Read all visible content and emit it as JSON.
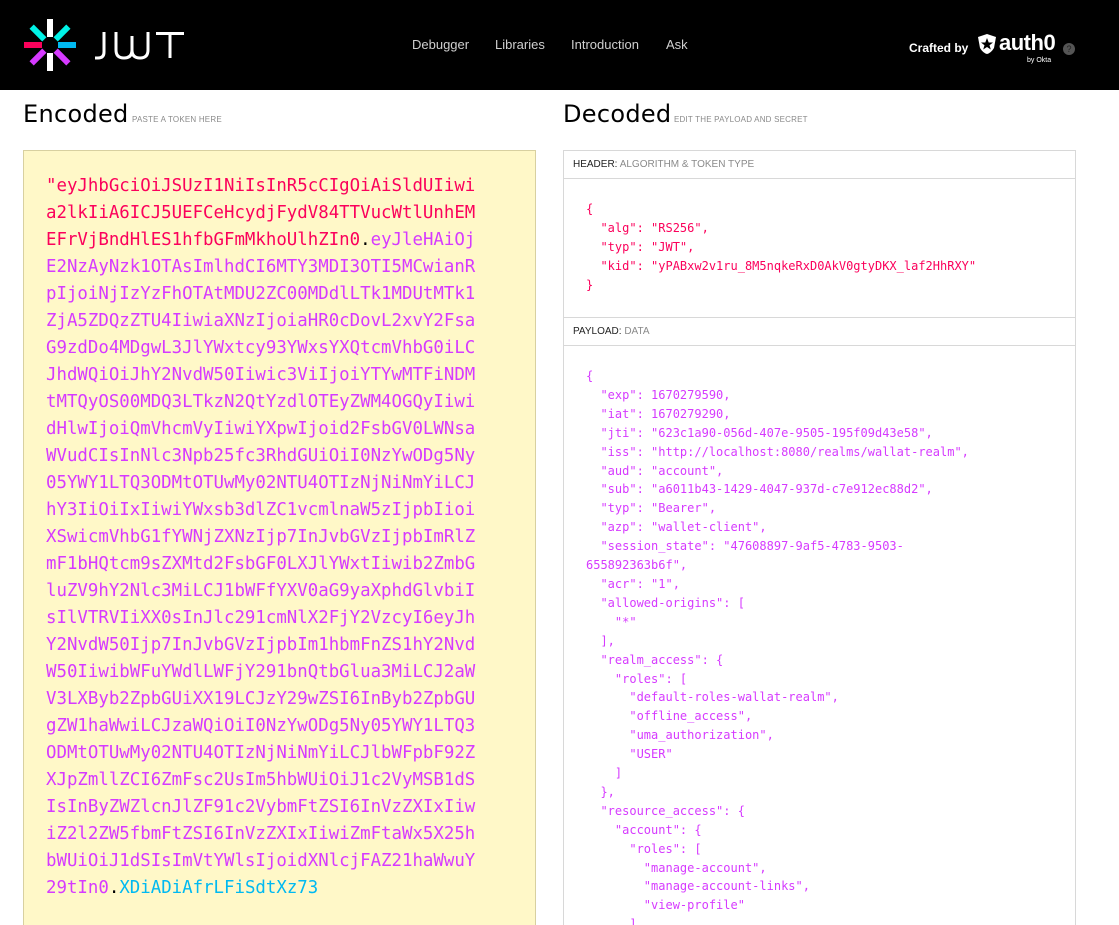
{
  "brand": {
    "wordmark": "JWT"
  },
  "nav": [
    "Debugger",
    "Libraries",
    "Introduction",
    "Ask"
  ],
  "crafted": {
    "label": "Crafted by",
    "brand": "auth0",
    "sub": "by Okta",
    "help": "?"
  },
  "encoded": {
    "title": "Encoded",
    "subtitle": "PASTE A TOKEN HERE",
    "token_header": "\"eyJhbGciOiJSUzI1NiIsInR5cCIgOiAiSldUIiwia2lkIiA6ICJ5UEFCeHcydjFydV84TTVucWtlUnhEMEFrVjBndHlES1hfbGFmMkhoUlhZIn0",
    "token_payload": "eyJleHAiOjE2NzAyNzk1OTAsImlhdCI6MTY3MDI3OTI5MCwianRpIjoiNjIzYzFhOTAtMDU2ZC00MDdlLTk1MDUtMTk1ZjA5ZDQzZTU4IiwiaXNzIjoiaHR0cDovL2xvY2FsaG9zdDo4MDgwL3JlYWxtcy93YWxsYXQtcmVhbG0iLCJhdWQiOiJhY2NvdW50Iiwic3ViIjoiYTYwMTFiNDMtMTQyOS00MDQ3LTkzN2QtYzdlOTEyZWM4OGQyIiwidHlwIjoiQmVhcmVyIiwiYXpwIjoid2FsbGV0LWNsaWVudCIsInNlc3Npb25fc3RhdGUiOiI0NzYwODg5Ny05YWY1LTQ3ODMtOTUwMy02NTU4OTIzNjNiNmYiLCJhY3IiOiIxIiwiYWxsb3dlZC1vcmlnaW5zIjpbIioiXSwicmVhbG1fYWNjZXNzIjp7InJvbGVzIjpbImRlZmF1bHQtcm9sZXMtd2FsbGF0LXJlYWxtIiwib2ZmbGluZV9hY2Nlc3MiLCJ1bWFfYXV0aG9yaXphdGlvbiIsIlVTRVIiXX0sInJlc291cmNlX2FjY2VzcyI6eyJhY2NvdW50Ijp7InJvbGVzIjpbIm1hbmFnZS1hY2NvdW50IiwibWFuYWdlLWFjY291bnQtbGlua3MiLCJ2aWV3LXByb2ZpbGUiXX19LCJzY29wZSI6InByb2ZpbGUgZW1haWwiLCJzaWQiOiI0NzYwODg5Ny05YWY1LTQ3ODMtOTUwMy02NTU4OTIzNjNiNmYiLCJlbWFpbF92ZXJpZmllZCI6ZmFsc2UsIm5hbWUiOiJ1c2VyMSB1dSIsInByZWZlcnJlZF91c2VybmFtZSI6InVzZXIxIiwiZ2l2ZW5fbmFtZSI6InVzZXIxIiwiZmFtaWx5X25hbWUiOiJ1dSIsImVtYWlsIjoidXNlcjFAZ21haWwuY29tIn0",
    "token_signature": "XDiADiAfrLFiSdtXz73"
  },
  "decoded": {
    "title": "Decoded",
    "subtitle": "EDIT THE PAYLOAD AND SECRET",
    "header_label": "HEADER:",
    "header_desc": "ALGORITHM & TOKEN TYPE",
    "header_json": "{\n  \"alg\": \"RS256\",\n  \"typ\": \"JWT\",\n  \"kid\": \"yPABxw2v1ru_8M5nqkeRxD0AkV0gtyDKX_laf2HhRXY\"\n}",
    "payload_label": "PAYLOAD:",
    "payload_desc": "DATA",
    "payload_json": "{\n  \"exp\": 1670279590,\n  \"iat\": 1670279290,\n  \"jti\": \"623c1a90-056d-407e-9505-195f09d43e58\",\n  \"iss\": \"http://localhost:8080/realms/wallat-realm\",\n  \"aud\": \"account\",\n  \"sub\": \"a6011b43-1429-4047-937d-c7e912ec88d2\",\n  \"typ\": \"Bearer\",\n  \"azp\": \"wallet-client\",\n  \"session_state\": \"47608897-9af5-4783-9503-\n655892363b6f\",\n  \"acr\": \"1\",\n  \"allowed-origins\": [\n    \"*\"\n  ],\n  \"realm_access\": {\n    \"roles\": [\n      \"default-roles-wallat-realm\",\n      \"offline_access\",\n      \"uma_authorization\",\n      \"USER\"\n    ]\n  },\n  \"resource_access\": {\n    \"account\": {\n      \"roles\": [\n        \"manage-account\",\n        \"manage-account-links\",\n        \"view-profile\"\n      ]"
  },
  "colors": {
    "header": "#fb015b",
    "payload": "#d63aff",
    "signature": "#00b9f1",
    "encoded_bg": "#fff8c8"
  }
}
